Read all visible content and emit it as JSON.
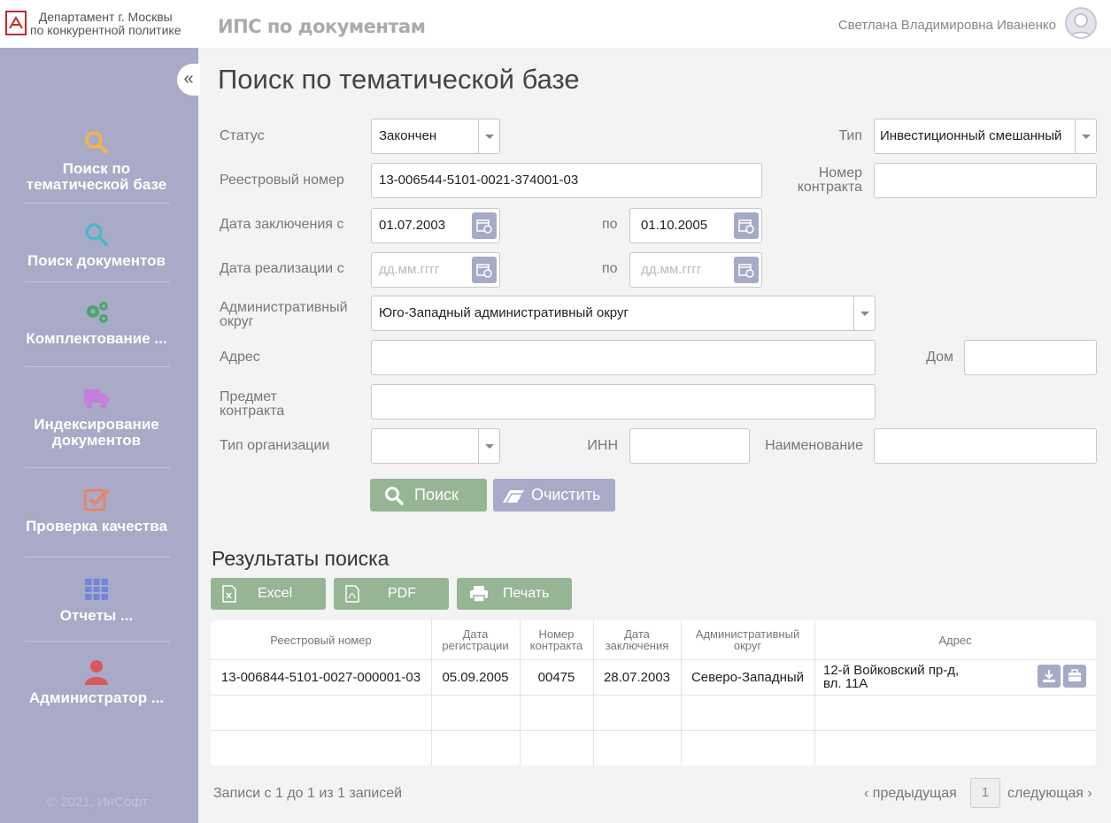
{
  "header": {
    "org_line1": "Департамент г. Москвы",
    "org_line2": "по конкурентной политике",
    "app_title": "ИПС по документам",
    "user_name": "Светлана Владимировна Иваненко"
  },
  "sidebar": {
    "items": [
      {
        "label": "Поиск по тематической базе",
        "icon": "search-icon",
        "color": "#f5b546"
      },
      {
        "label": "Поиск документов",
        "icon": "search-icon",
        "color": "#4fb6c9"
      },
      {
        "label": "Комплектование ...",
        "icon": "gears-icon",
        "color": "#4aa86a"
      },
      {
        "label": "Индексирование документов",
        "icon": "truck-icon",
        "color": "#c77ddb"
      },
      {
        "label": "Проверка качества",
        "icon": "checkbox-icon",
        "color": "#e8846b"
      },
      {
        "label": "Отчеты ...",
        "icon": "grid-icon",
        "color": "#6f86dc"
      },
      {
        "label": "Администратор ...",
        "icon": "user-icon",
        "color": "#d9575f"
      }
    ],
    "copyright": "© 2021, ИнСофт"
  },
  "page_title": "Поиск по тематической базе",
  "form": {
    "status_label": "Статус",
    "status_value": "Закончен",
    "type_label": "Тип",
    "type_value": "Инвестиционный смешанный",
    "registry_label": "Реестровый номер",
    "registry_value": "13-006544-5101-0021-374001-03",
    "contract_no_label": "Номер контракта",
    "contract_no_value": "",
    "concl_from_label": "Дата заключения с",
    "concl_from_value": "01.07.2003",
    "concl_to_label": "по",
    "concl_to_value": "01.10.2005",
    "real_from_label": "Дата реализации с",
    "real_from_placeholder": "дд.мм.гггг",
    "real_to_label": "по",
    "real_to_placeholder": "дд.мм.гггг",
    "district_label": "Административный округ",
    "district_value": "Юго-Западный административный округ",
    "address_label": "Адрес",
    "address_value": "",
    "house_label": "Дом",
    "house_value": "",
    "subject_label": "Предмет контракта",
    "subject_value": "",
    "org_type_label": "Тип организации",
    "org_type_value": "",
    "inn_label": "ИНН",
    "inn_value": "",
    "name_label": "Наименование",
    "name_value": "",
    "search_button": "Поиск",
    "clear_button": "Очистить"
  },
  "results": {
    "title": "Результаты поиска",
    "export_excel": "Excel",
    "export_pdf": "PDF",
    "print": "Печать",
    "columns": [
      "Реестровый номер",
      "Дата регистрации",
      "Номер контракта",
      "Дата заключения",
      "Административный округ",
      "Адрес"
    ],
    "rows": [
      {
        "registry": "13-006844-5101-0027-000001-03",
        "reg_date": "05.09.2005",
        "contract_no": "00475",
        "concl_date": "28.07.2003",
        "district": "Северо-Западный",
        "address": "12-й Войковский пр-д, вл. 11А"
      }
    ],
    "records_info": "Записи с 1 до 1 из 1 записей",
    "prev": "предыдущая",
    "page": "1",
    "next": "следующая"
  }
}
